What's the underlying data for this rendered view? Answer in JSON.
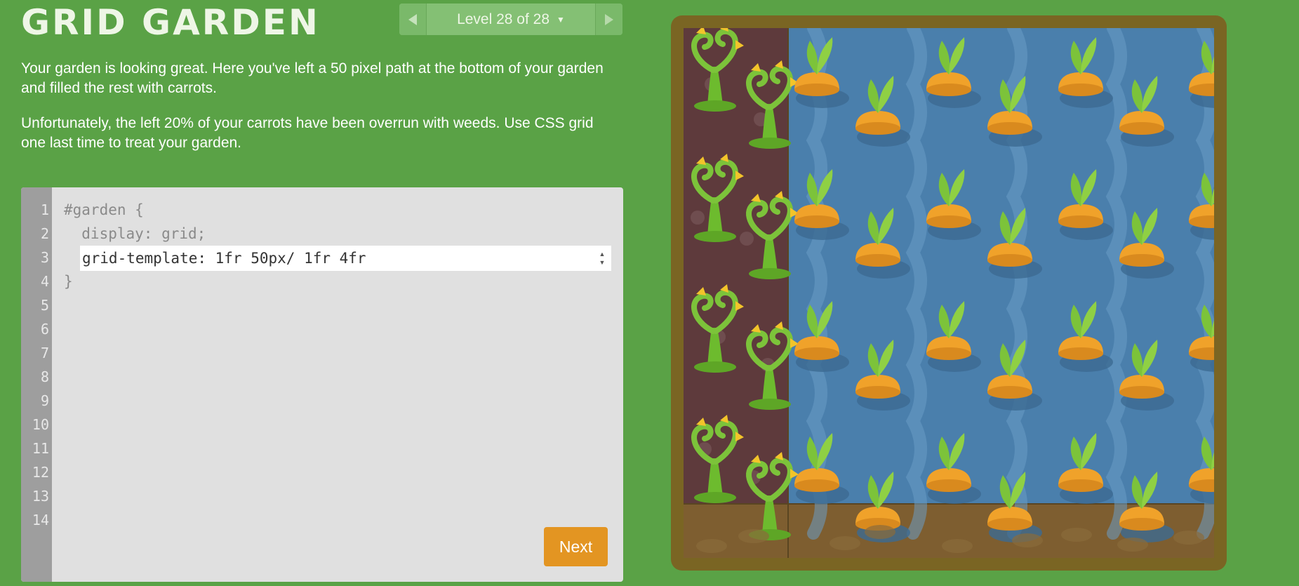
{
  "header": {
    "title": "GRID GARDEN",
    "level_label": "Level 28 of 28",
    "prev_icon": "triangle-left-icon",
    "next_icon": "triangle-right-icon",
    "dropdown_icon": "caret-down-icon"
  },
  "instructions": {
    "paragraph1": "Your garden is looking great. Here you've left a 50 pixel path at the bottom of your garden and filled the rest with carrots.",
    "paragraph2": "Unfortunately, the left 20% of your carrots have been overrun with weeds. Use CSS grid one last time to treat your garden."
  },
  "editor": {
    "line_numbers": [
      "1",
      "2",
      "3",
      "4",
      "5",
      "6",
      "7",
      "8",
      "9",
      "10",
      "11",
      "12",
      "13",
      "14"
    ],
    "line1": "#garden {",
    "line2": "  display: grid;",
    "input_value": "grid-template: 1fr 50px/ 1fr 4fr",
    "line4": "}",
    "next_label": "Next"
  },
  "colors": {
    "background": "#5aa246",
    "weed_bed": "#5e3a3c",
    "water_bed": "#4a7fac",
    "path": "#7e5e30",
    "frame": "#7a6523",
    "carrot": "#f0a22a",
    "leaf": "#7cc33a",
    "next_button": "#e39522"
  }
}
